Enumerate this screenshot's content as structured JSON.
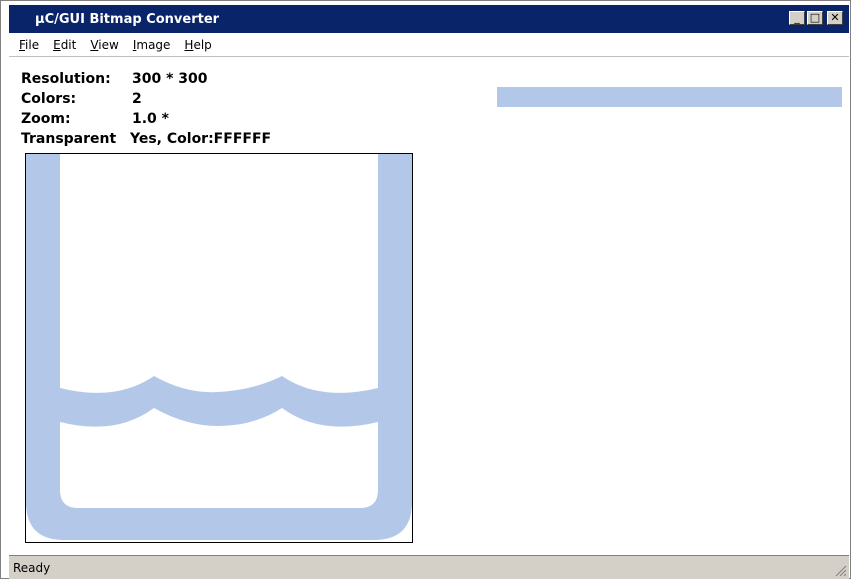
{
  "window": {
    "title": "µC/GUI Bitmap Converter",
    "buttons": {
      "minimize": "_",
      "maximize": "□",
      "close": "✕"
    }
  },
  "menu": [
    {
      "mnemonic": "F",
      "rest": "ile"
    },
    {
      "mnemonic": "E",
      "rest": "dit"
    },
    {
      "mnemonic": "V",
      "rest": "iew"
    },
    {
      "mnemonic": "I",
      "rest": "mage"
    },
    {
      "mnemonic": "H",
      "rest": "elp"
    }
  ],
  "info": {
    "resolution_label": "Resolution:",
    "resolution_value": "300 * 300",
    "colors_label": "Colors:",
    "colors_value": "2",
    "zoom_label": "Zoom:",
    "zoom_value": "1.0 *",
    "transparent_label": "Transparent",
    "transparent_value": "Yes, Color:FFFFFF"
  },
  "status": {
    "text": "Ready"
  },
  "colors": {
    "titlebar": "#0a246a",
    "image_blue": "#b3c8e8",
    "statusbar": "#d4d0c8"
  },
  "icons": {
    "resize_grip": "resize-grip-icon"
  }
}
